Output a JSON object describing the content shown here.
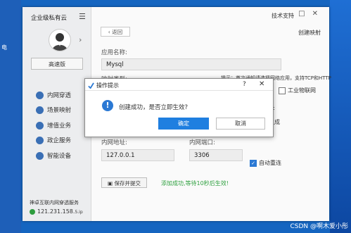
{
  "desktop": {
    "left_label": "电"
  },
  "app": {
    "sidebar": {
      "title": "企业级私有云",
      "version_button": "高速版",
      "nav": [
        {
          "label": "内网穿透",
          "icon": "network-icon"
        },
        {
          "label": "场景映射",
          "icon": "scene-icon"
        },
        {
          "label": "增值业务",
          "icon": "stack-icon"
        },
        {
          "label": "政企服务",
          "icon": "building-icon"
        },
        {
          "label": "智能设备",
          "icon": "device-icon"
        }
      ],
      "footer_title": "神卓互联内网穿透服务",
      "ip": "121.231.158.",
      "ip_suffix": "5.ip"
    },
    "header": {
      "tech_support": "技术支持",
      "back": "返回",
      "create_mapping": "创建映射"
    },
    "form": {
      "app_name_label": "应用名称:",
      "app_name_value": "Mysql",
      "mapping_type_label": "映射类型:",
      "note": "提示：首次通知请选择网络应用，支持TCP和HTTP",
      "iot_label": "工业物联网",
      "frag_right1": "口:",
      "frag_right2": "生成",
      "intranet_addr_label": "内网地址:",
      "intranet_addr_value": "127.0.0.1",
      "intranet_port_label": "内网端口:",
      "intranet_port_value": "3306",
      "auto_reconnect_label": "自动重连",
      "save_button": "保存并提交",
      "success_text": "添加成功,等待10秒后生效!"
    }
  },
  "dialog": {
    "title": "操作提示",
    "help": "?",
    "close": "✕",
    "message": "创建成功，是否立即生效?",
    "ok": "确定",
    "cancel": "取消"
  },
  "watermark": "CSDN @啊木爱小彤",
  "colors": {
    "accent": "#1f7fe0",
    "success": "#2ea03f",
    "desktop": "#1565c0"
  }
}
